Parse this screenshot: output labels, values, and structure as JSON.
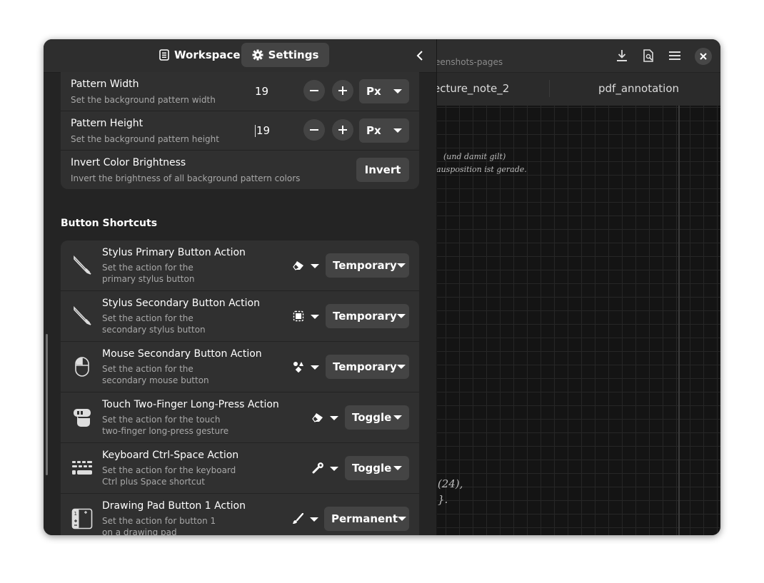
{
  "sidebar": {
    "tabs": [
      {
        "label": "Workspace",
        "icon": "document-icon"
      },
      {
        "label": "Settings",
        "icon": "gear-icon"
      }
    ],
    "pattern": {
      "width_title": "Pattern Width",
      "width_sub": "Set the background pattern width",
      "width_value": "19",
      "width_unit": "Px",
      "height_title": "Pattern Height",
      "height_sub": "Set the background pattern height",
      "height_value": "19",
      "height_unit": "Px",
      "invert_title": "Invert Color Brightness",
      "invert_sub": "Invert the brightness of all background pattern colors",
      "invert_label": "Invert"
    },
    "section_title": "Button Shortcuts",
    "shortcuts": [
      {
        "title": "Stylus Primary Button Action",
        "sub1": "Set the action for the",
        "sub2": "primary stylus button",
        "action_icon": "eraser-icon",
        "mode": "Temporary"
      },
      {
        "title": "Stylus Secondary Button Action",
        "sub1": "Set the action for the",
        "sub2": "secondary stylus button",
        "action_icon": "selector-icon",
        "mode": "Temporary"
      },
      {
        "title": "Mouse Secondary Button Action",
        "sub1": "Set the action for the",
        "sub2": "secondary mouse button",
        "action_icon": "shapes-icon",
        "mode": "Temporary"
      },
      {
        "title": "Touch Two-Finger Long-Press Action",
        "sub1": "Set the action for the touch",
        "sub2": "two-finger long-press gesture",
        "action_icon": "eraser-icon",
        "mode": "Toggle"
      },
      {
        "title": "Keyboard Ctrl-Space Action",
        "sub1": "Set the action for the keyboard",
        "sub2": "Ctrl plus Space shortcut",
        "action_icon": "wrench-icon",
        "mode": "Toggle"
      },
      {
        "title": "Drawing Pad Button 1 Action",
        "sub1": "Set the action for button 1",
        "sub2": "on a drawing pad",
        "action_icon": "brush-icon",
        "mode": "Permanent"
      }
    ]
  },
  "canvas": {
    "path": "eenshots-pages",
    "tabs": [
      "ecture_note_2",
      "pdf_annotation"
    ],
    "scribbles": [
      "(und damit gilt)",
      "ausposition ist gerade.",
      ")(24),",
      "}."
    ]
  },
  "colors": {
    "window_bg": "#242424",
    "accent": "#444444"
  }
}
